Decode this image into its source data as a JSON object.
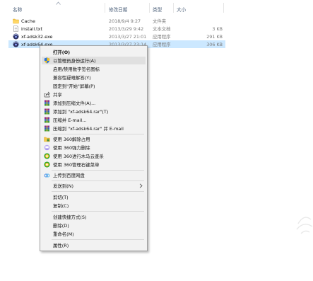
{
  "columns": {
    "name": "名称",
    "date": "修改日期",
    "type": "类型",
    "size": "大小"
  },
  "files": [
    {
      "name": "Cache",
      "date": "2018/9/4 9:27",
      "type": "文件夹",
      "size": "",
      "icon": "folder-icon",
      "selected": false
    },
    {
      "name": "install.txt",
      "date": "2013/3/29 9:42",
      "type": "文本文档",
      "size": "3 KB",
      "icon": "text-file-icon",
      "selected": false
    },
    {
      "name": "xf-adsk32.exe",
      "date": "2013/3/27 21:01",
      "type": "应用程序",
      "size": "291 KB",
      "icon": "app-icon",
      "selected": false
    },
    {
      "name": "xf-adsk64.exe",
      "date": "2013/3/27 23:14",
      "type": "应用程序",
      "size": "306 KB",
      "icon": "app-icon",
      "selected": true
    }
  ],
  "context_menu": {
    "items": [
      {
        "label": "打开(O)",
        "bold": true,
        "icon": ""
      },
      {
        "label": "以管理员身份运行(A)",
        "icon": "shield-icon",
        "hover": true
      },
      {
        "label": "启用/禁用数字签名图标",
        "icon": ""
      },
      {
        "label": "兼容性疑难解答(Y)",
        "icon": ""
      },
      {
        "label": "固定到\"开始\"屏幕(P)",
        "icon": ""
      },
      {
        "label": "共享",
        "icon": "share-icon"
      },
      {
        "label": "添加到压缩文件(A)...",
        "icon": "winrar-icon"
      },
      {
        "label": "添加到 \"xf-adsk64.rar\"(T)",
        "icon": "winrar-icon"
      },
      {
        "label": "压缩并 E-mail...",
        "icon": "winrar-icon"
      },
      {
        "label": "压缩到 \"xf-adsk64.rar\" 并 E-mail",
        "icon": "winrar-icon"
      },
      {
        "label": "使用 360解除占用",
        "icon": "folder-lock-icon"
      },
      {
        "label": "使用 360强力删除",
        "icon": "shred-icon"
      },
      {
        "label": "使用 360进行木马云查杀",
        "icon": "360-icon"
      },
      {
        "label": "使用 360管理右键菜单",
        "icon": "360-icon"
      },
      {
        "label": "上传到百度网盘",
        "icon": "baidu-cloud-icon"
      },
      {
        "label": "发送到(N)",
        "icon": "",
        "submenu": true
      },
      {
        "label": "剪切(T)",
        "icon": ""
      },
      {
        "label": "复制(C)",
        "icon": ""
      },
      {
        "label": "创建快捷方式(S)",
        "icon": ""
      },
      {
        "label": "删除(D)",
        "icon": ""
      },
      {
        "label": "重命名(M)",
        "icon": ""
      },
      {
        "label": "属性(R)",
        "icon": ""
      }
    ]
  }
}
